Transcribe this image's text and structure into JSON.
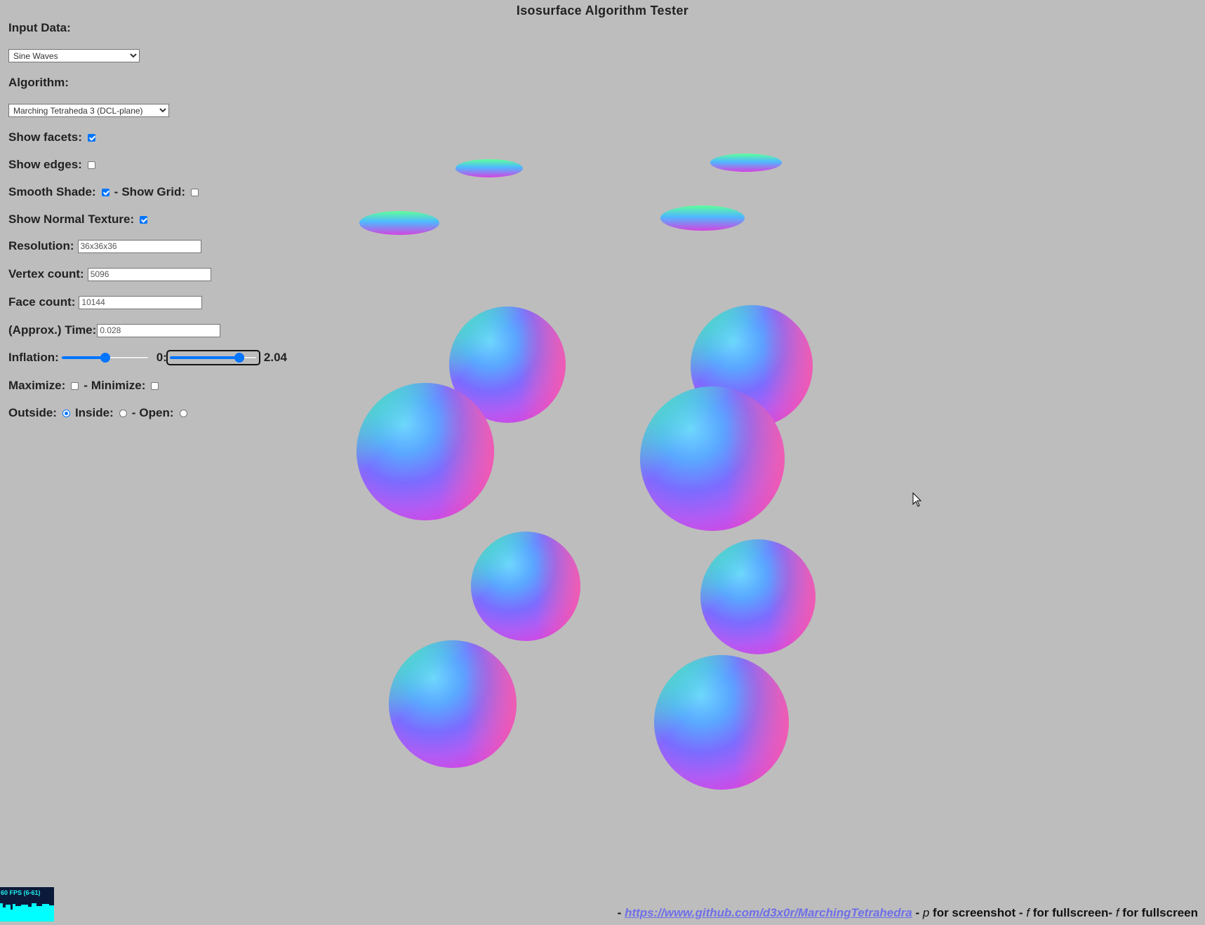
{
  "app": {
    "title": "Isosurface Algorithm Tester"
  },
  "controls": {
    "input_data_label": "Input Data:",
    "input_data_value": "Sine Waves",
    "algorithm_label": "Algorithm:",
    "algorithm_value": "Marching Tetraheda 3 (DCL-plane)",
    "show_facets_label": "Show facets:",
    "show_facets": true,
    "show_edges_label": "Show edges:",
    "show_edges": false,
    "smooth_shade_label": "Smooth Shade:",
    "smooth_shade": true,
    "show_grid_sep": "-",
    "show_grid_label": "Show Grid:",
    "show_grid": false,
    "show_normal_texture_label": "Show Normal Texture:",
    "show_normal_texture": true,
    "resolution_label": "Resolution:",
    "resolution_value": "36x36x36",
    "vertex_count_label": "Vertex count:",
    "vertex_count_value": "5096",
    "face_count_label": "Face count:",
    "face_count_value": "10144",
    "time_label": "(Approx.) Time:",
    "time_value": "0.028",
    "inflation_label": "Inflation:",
    "inflation_level": 0.5,
    "range_prefix": "0:",
    "range_level": 0.84,
    "range_value": "2.04",
    "maximize_label": "Maximize:",
    "maximize": false,
    "minimize_sep": "-",
    "minimize_label": "Minimize:",
    "minimize": false,
    "outside_label": "Outside:",
    "outside": true,
    "inside_label": "Inside:",
    "inside": false,
    "open_sep": "-",
    "open_label": "Open:",
    "open": false
  },
  "footer": {
    "dash": "-",
    "link_text": "https://www.github.com/d3x0r/MarchingTetrahedra",
    "sep1": "-",
    "key1": "p",
    "text1": "for screenshot -",
    "key2": "f",
    "text2": "for fullscreen-",
    "key3": "f",
    "text3": "for fullscreen"
  },
  "stats": {
    "fps_text": "60 FPS (6-61)"
  },
  "colors": {
    "background": "#bdbdbd",
    "accent": "#0075ff",
    "link": "#6f6fe8"
  }
}
